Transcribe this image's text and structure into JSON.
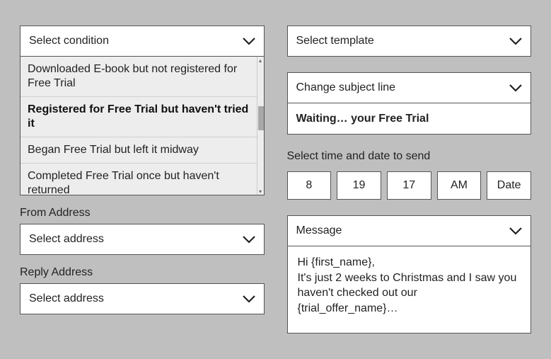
{
  "left": {
    "condition_select": {
      "label": "Select condition"
    },
    "condition_options": [
      {
        "label": "Downloaded E-book but not registered for Free Trial",
        "selected": false
      },
      {
        "label": "Registered for Free Trial but haven't tried it",
        "selected": true
      },
      {
        "label": "Began Free Trial but left it midway",
        "selected": false
      },
      {
        "label": "Completed Free Trial once but haven't returned",
        "selected": false
      }
    ],
    "from_address_label": "From Address",
    "from_address_select": {
      "label": "Select address"
    },
    "reply_address_label": "Reply Address",
    "reply_address_select": {
      "label": "Select address"
    }
  },
  "right": {
    "template_select": {
      "label": "Select template"
    },
    "subject_select": {
      "label": "Change subject line"
    },
    "subject_value": "Waiting… your Free Trial",
    "time_label": "Select time and date to send",
    "time": {
      "hour": "8",
      "minute": "19",
      "second": "17",
      "ampm": "AM",
      "date": "Date"
    },
    "message_select": {
      "label": "Message"
    },
    "message_body": "Hi {first_name},\nIt's just 2 weeks to Christmas and I saw you haven't checked out our {trial_offer_name}…"
  }
}
